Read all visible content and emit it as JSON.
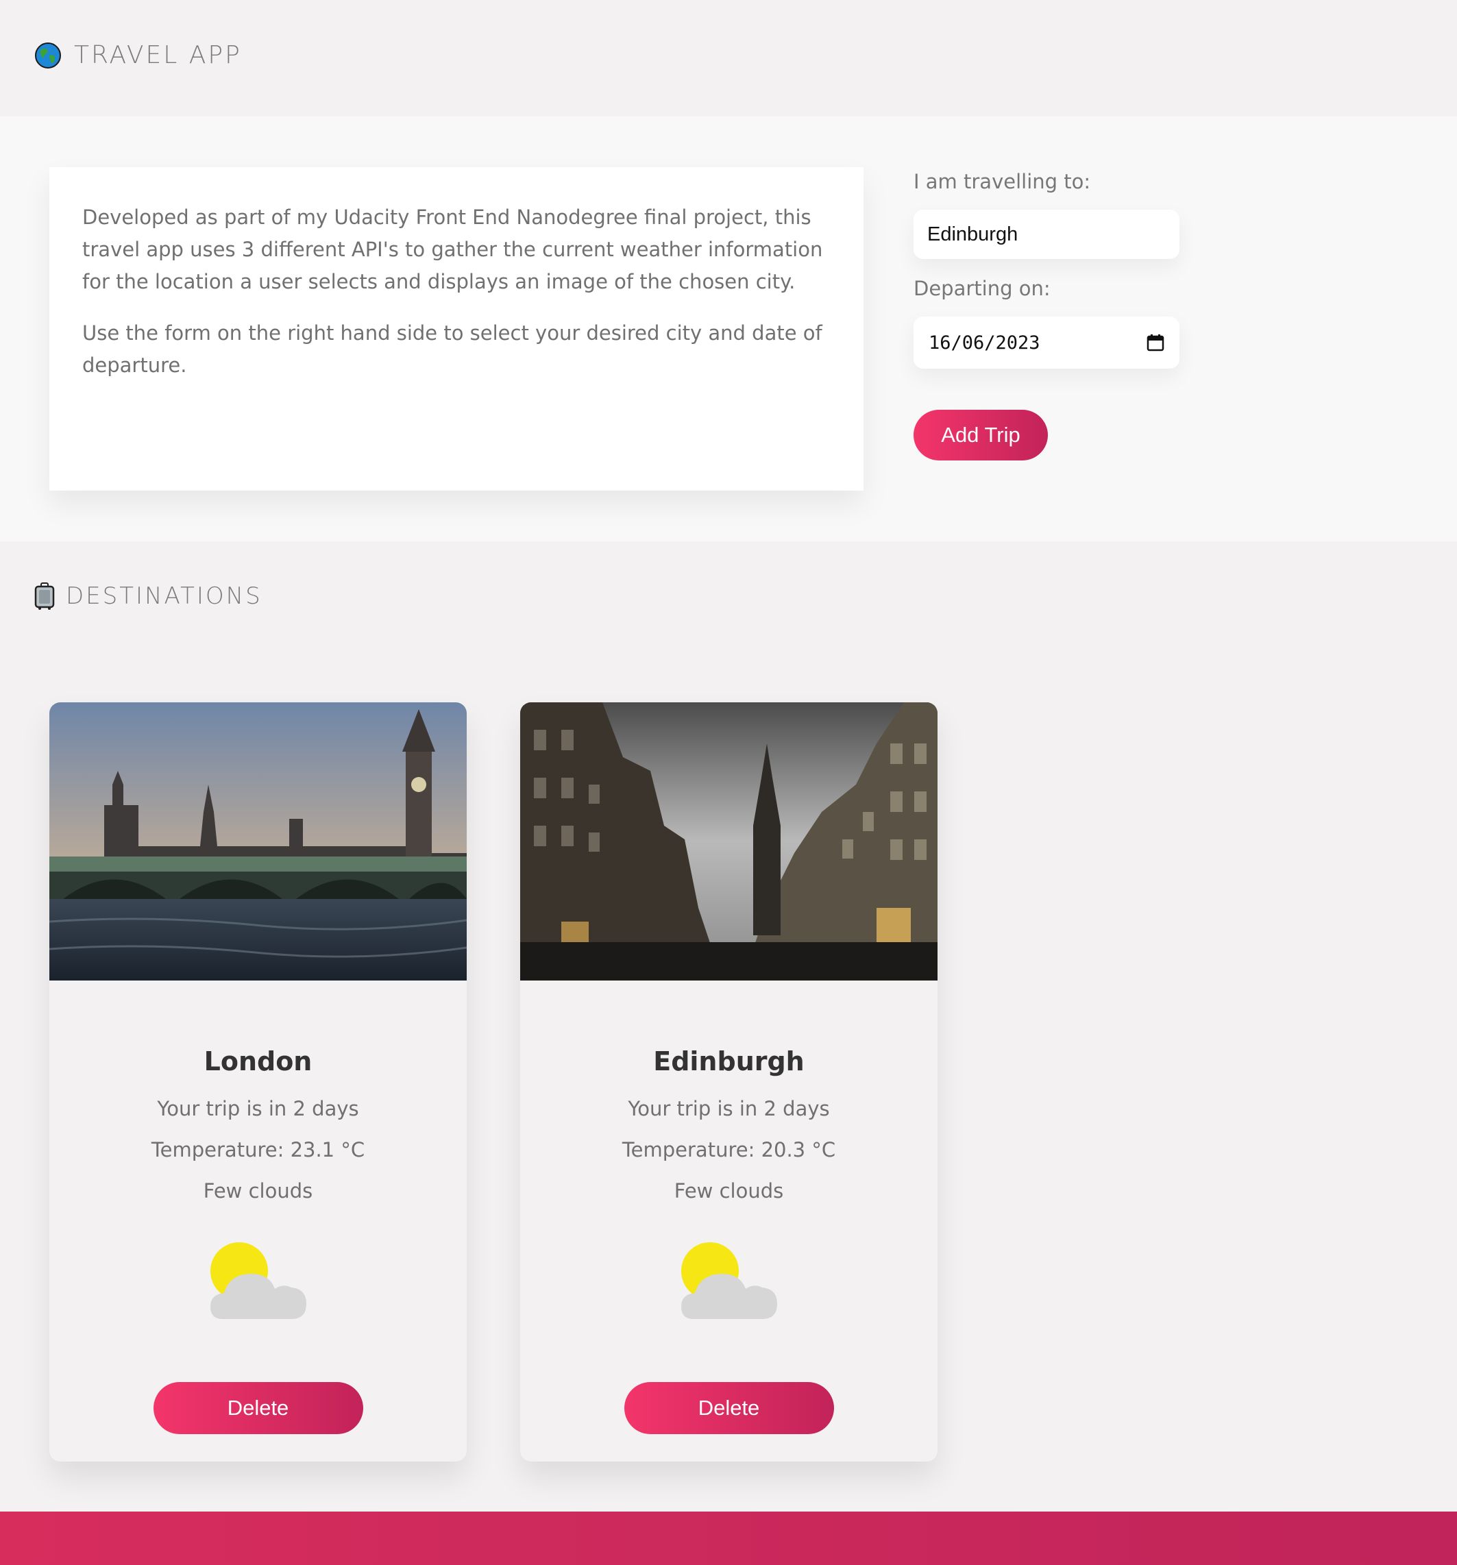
{
  "header": {
    "title": "TRAVEL APP",
    "icon": "globe-icon"
  },
  "intro": {
    "paragraph1": "Developed as part of my Udacity Front End Nanodegree final project, this travel app uses 3 different API's to gather the current weather information for the location a user selects and displays an image of the chosen city.",
    "paragraph2": "Use the form on the right hand side to select your desired city and date of departure."
  },
  "form": {
    "destination_label": "I am travelling to:",
    "destination_value": "Edinburgh",
    "date_label": "Departing on:",
    "date_value": "16/06/2023",
    "submit_label": "Add Trip"
  },
  "destinations": {
    "title": "DESTINATIONS",
    "icon": "luggage-icon",
    "items": [
      {
        "city": "London",
        "countdown": "Your trip is in 2 days",
        "temperature": "Temperature: 23.1 °C",
        "description": "Few clouds",
        "weather_icon": "few-clouds-icon",
        "delete_label": "Delete"
      },
      {
        "city": "Edinburgh",
        "countdown": "Your trip is in 2 days",
        "temperature": "Temperature: 20.3 °C",
        "description": "Few clouds",
        "weather_icon": "few-clouds-icon",
        "delete_label": "Delete"
      }
    ]
  },
  "colors": {
    "accent": "#f3356a",
    "accent_dark": "#c2235a",
    "background": "#f3f1f1",
    "sun": "#f5e614",
    "cloud": "#d6d6d6"
  }
}
